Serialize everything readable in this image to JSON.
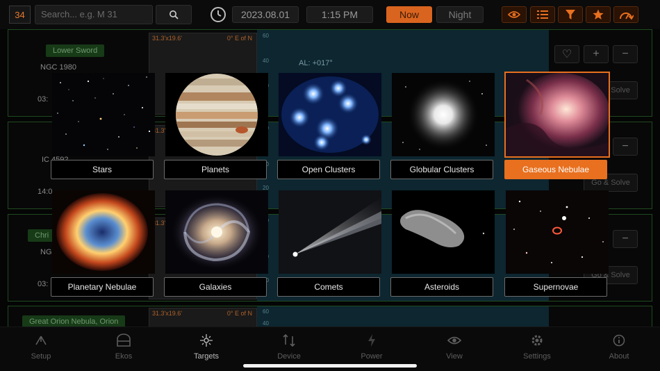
{
  "topbar": {
    "target_count": "34",
    "search_placeholder": "Search... e.g. M 31",
    "date": "2023.08.01",
    "time": "1:15 PM",
    "now_label": "Now",
    "night_label": "Night",
    "tools": [
      "eye-icon",
      "list-icon",
      "filter-icon",
      "star-icon",
      "refresh-icon"
    ],
    "accent": "#e8701f"
  },
  "cards": [
    {
      "name": "Lower Sword",
      "catalog": "NGC 1980",
      "fov": "31.3'x19.6'",
      "pa": "0° E of N",
      "time": "03:",
      "alt_text": "AL: +017°",
      "graph_ticks": [
        "60",
        "40",
        "20"
      ],
      "solve_label": "Go & Solve"
    },
    {
      "name": "",
      "catalog": "IC 4592",
      "fov": "31.3'",
      "pa": "",
      "time": "14:0",
      "alt_text": "",
      "graph_ticks": [
        "60",
        "40",
        "20"
      ],
      "solve_label": "Go & Solve"
    },
    {
      "name": "Chri",
      "catalog": "NG",
      "fov": "31.3'",
      "pa": "",
      "time": "03:",
      "alt_text": "",
      "graph_ticks": [
        "60",
        "40",
        "20"
      ],
      "solve_label": "Go & Solve"
    },
    {
      "name": "Great Orion Nebula, Orion",
      "catalog": "",
      "fov": "31.3'x19.6'",
      "pa": "0° E of N",
      "time": "",
      "alt_text": "",
      "graph_ticks": [
        "60",
        "40"
      ],
      "solve_label": ""
    }
  ],
  "categories": [
    {
      "label": "Stars",
      "image": "stars",
      "selected": false
    },
    {
      "label": "Planets",
      "image": "planets",
      "selected": false
    },
    {
      "label": "Open Clusters",
      "image": "open-clusters",
      "selected": false
    },
    {
      "label": "Globular Clusters",
      "image": "globular-clusters",
      "selected": false
    },
    {
      "label": "Gaseous Nebulae",
      "image": "gaseous-nebulae",
      "selected": true
    },
    {
      "label": "Planetary Nebulae",
      "image": "planetary-nebulae",
      "selected": false
    },
    {
      "label": "Galaxies",
      "image": "galaxies",
      "selected": false
    },
    {
      "label": "Comets",
      "image": "comets",
      "selected": false
    },
    {
      "label": "Asteroids",
      "image": "asteroids",
      "selected": false
    },
    {
      "label": "Supernovae",
      "image": "supernovae",
      "selected": false
    }
  ],
  "bottom_nav": [
    {
      "label": "Setup",
      "icon": "setup-icon",
      "active": false
    },
    {
      "label": "Ekos",
      "icon": "ekos-icon",
      "active": false
    },
    {
      "label": "Targets",
      "icon": "targets-icon",
      "active": true
    },
    {
      "label": "Device",
      "icon": "device-icon",
      "active": false
    },
    {
      "label": "Power",
      "icon": "power-icon",
      "active": false
    },
    {
      "label": "View",
      "icon": "view-icon",
      "active": false
    },
    {
      "label": "Settings",
      "icon": "settings-icon",
      "active": false
    },
    {
      "label": "About",
      "icon": "about-icon",
      "active": false
    }
  ]
}
